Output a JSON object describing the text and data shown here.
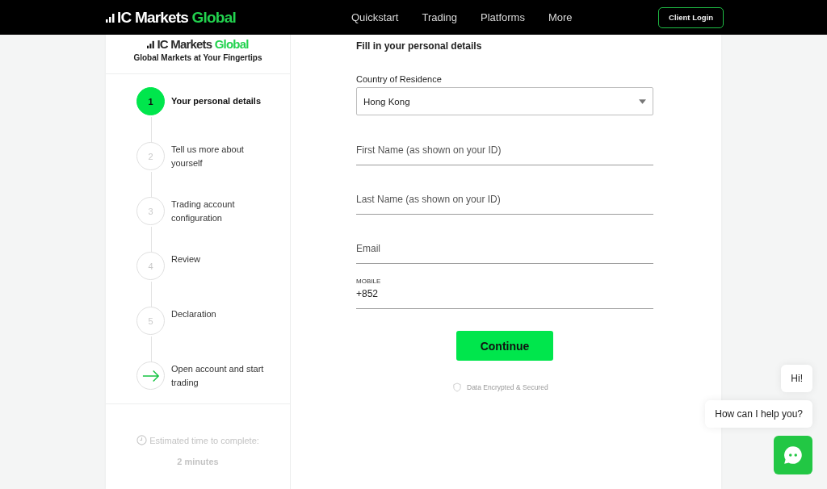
{
  "header": {
    "logo": {
      "brand": "IC Markets",
      "accent": "Global"
    },
    "nav": [
      {
        "label": "Quickstart"
      },
      {
        "label": "Trading"
      },
      {
        "label": "Platforms"
      },
      {
        "label": "More"
      }
    ],
    "login_button": "Client Login"
  },
  "sidebar": {
    "logo": {
      "brand": "IC Markets",
      "accent": "Global"
    },
    "tagline": "Global Markets at Your Fingertips",
    "steps": [
      {
        "kind": "number",
        "number": "1",
        "label": "Your personal details",
        "selected": true
      },
      {
        "kind": "number",
        "number": "2",
        "label": "Tell us more about yourself",
        "selected": false
      },
      {
        "kind": "number",
        "number": "3",
        "label": "Trading account configuration",
        "selected": false
      },
      {
        "kind": "number",
        "number": "4",
        "label": "Review",
        "selected": false
      },
      {
        "kind": "number",
        "number": "5",
        "label": "Declaration",
        "selected": false
      },
      {
        "kind": "arrow",
        "label": "Open account and start trading",
        "selected": false
      }
    ],
    "estimate_label": "Estimated time to complete:",
    "estimate_value": "2 minutes"
  },
  "form": {
    "heading": "Fill in your personal details",
    "fields": [
      {
        "kind": "select",
        "label": "Country of Residence",
        "value": "Hong Kong"
      },
      {
        "kind": "text",
        "placeholder": "First Name (as shown on your ID)"
      },
      {
        "kind": "text",
        "placeholder": "Last Name (as shown on your ID)"
      },
      {
        "kind": "text",
        "placeholder": "Email"
      },
      {
        "kind": "text",
        "label": "MOBILE",
        "value": "+852"
      }
    ],
    "submit": "Continue",
    "security_note": "Data Encrypted & Secured"
  },
  "chat": {
    "messages": [
      "Hi!",
      "How can I help you?"
    ]
  }
}
